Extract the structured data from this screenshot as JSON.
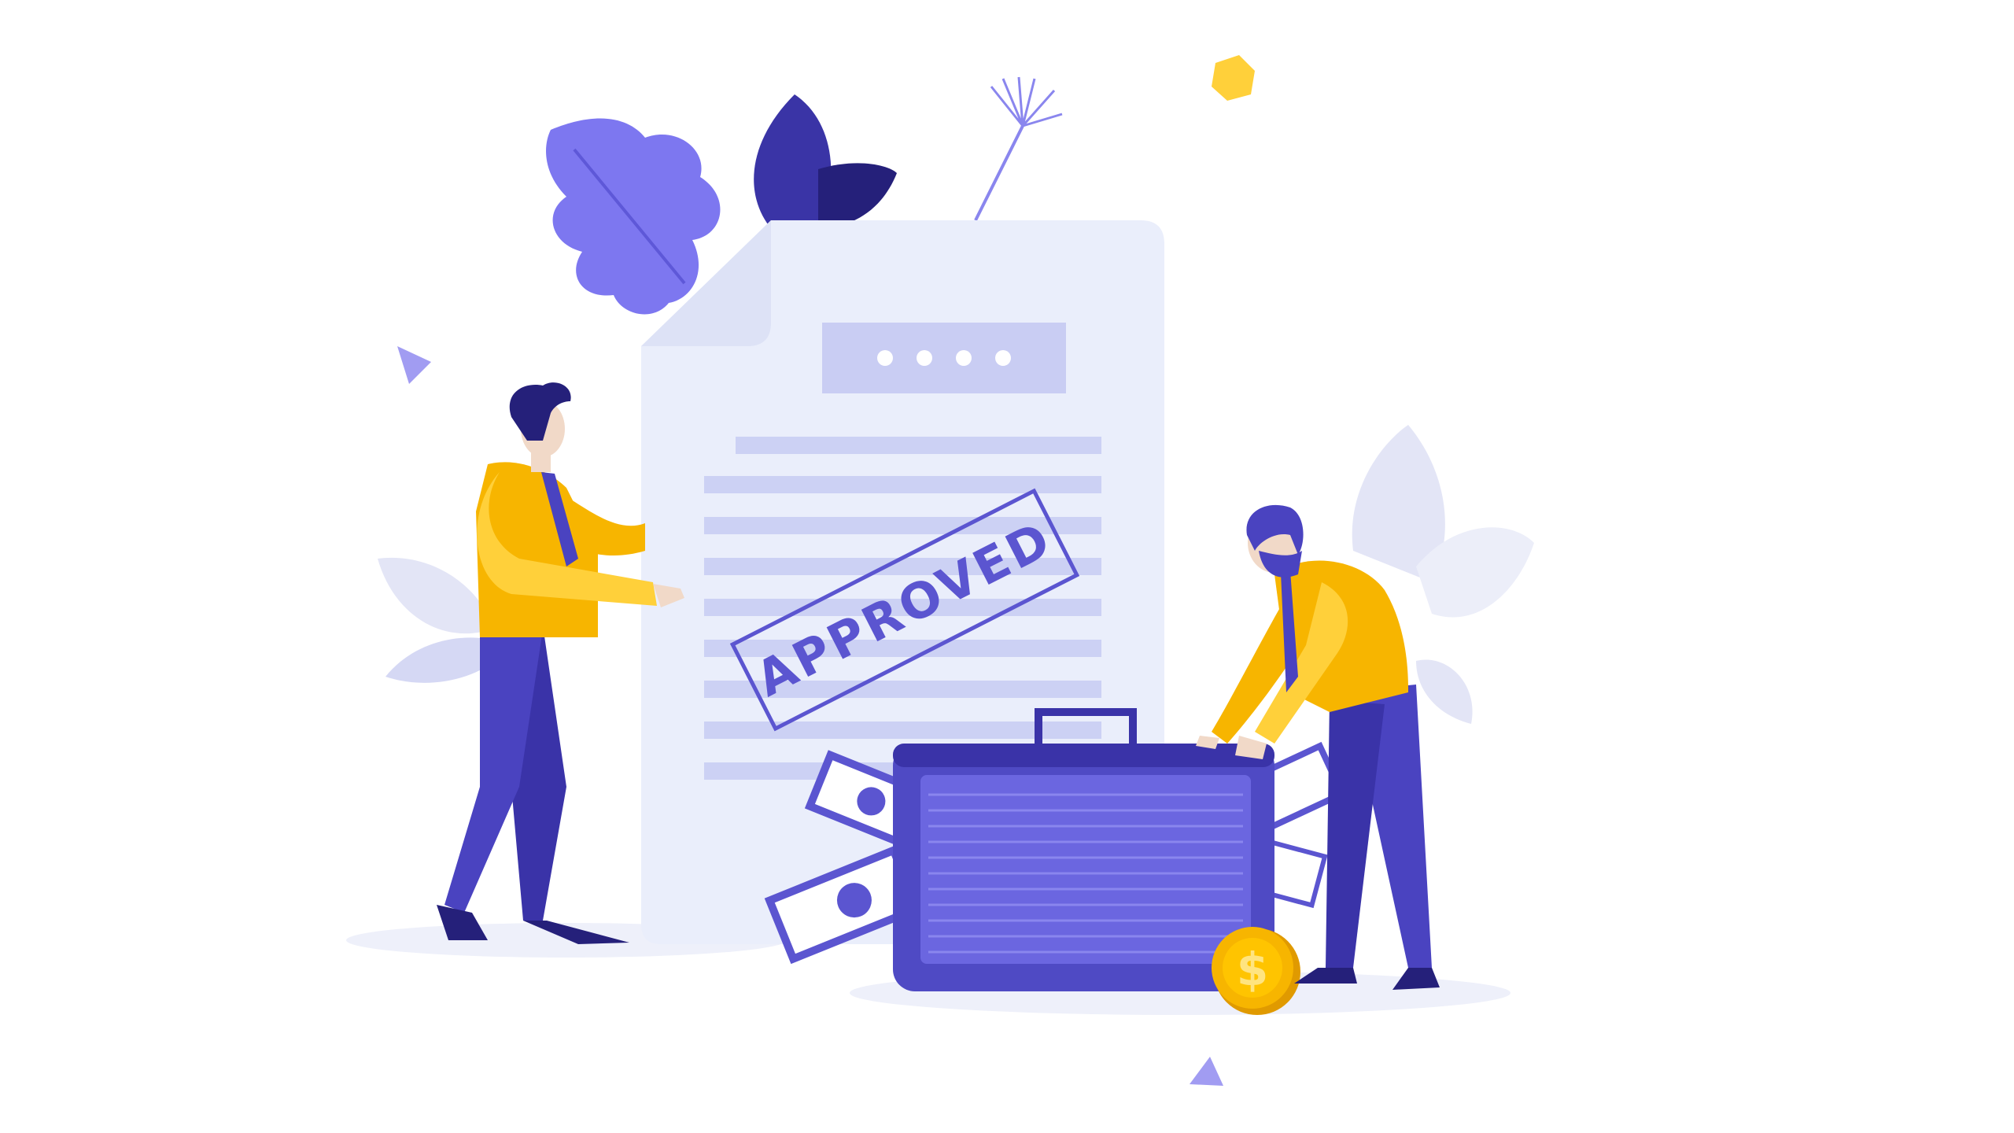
{
  "illustration": {
    "stamp_text": "APPROVED",
    "coin_symbol": "$"
  },
  "colors": {
    "background": "#ffffff",
    "document": "#eaeefb",
    "document_fold": "#dde2f6",
    "document_lines": "#ccd1f4",
    "header_box": "#c9cdf3",
    "stamp": "#5b55d0",
    "suitcase_body": "#4f4ac4",
    "suitcase_panel": "#6b66e0",
    "suitcase_lines": "#8a86ee",
    "shirt": "#f7b500",
    "shirt_light": "#ffd03a",
    "pants": "#4a43c0",
    "pants_dark": "#3a33a8",
    "hair": "#25207a",
    "skin": "#f1d9c8",
    "leaf_light": "#7d77f0",
    "leaf_dark": "#3a34a6",
    "leaf_pale": "#e3e5f6",
    "coin": "#f7b500",
    "coin_dark": "#e09a00",
    "shadow": "#eef0fa"
  },
  "icons": [
    "document-icon",
    "approved-stamp-icon",
    "suitcase-icon",
    "coin-icon",
    "banknote-icon",
    "leaf-icon",
    "dandelion-icon",
    "hexagon-icon",
    "triangle-icon"
  ]
}
